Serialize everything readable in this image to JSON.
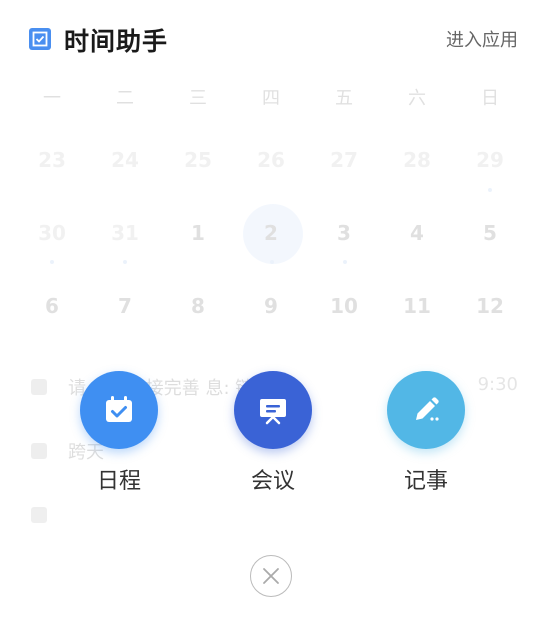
{
  "header": {
    "title": "时间助手",
    "enter_label": "进入应用"
  },
  "calendar": {
    "weekdays": [
      "一",
      "二",
      "三",
      "四",
      "五",
      "六",
      "日"
    ],
    "weeks": [
      [
        "23",
        "24",
        "25",
        "26",
        "27",
        "28",
        "29"
      ],
      [
        "30",
        "31",
        "1",
        "2",
        "3",
        "4",
        "5"
      ],
      [
        "6",
        "7",
        "8",
        "9",
        "10",
        "11",
        "12"
      ]
    ],
    "today": "2"
  },
  "events": [
    {
      "text": "请…    方链接完善    息:    链…",
      "right": "9:30"
    },
    {
      "text": "跨天",
      "right": ""
    },
    {
      "text": "",
      "right": ""
    }
  ],
  "actions": {
    "schedule_label": "日程",
    "meeting_label": "会议",
    "notes_label": "记事"
  },
  "colors": {
    "accent": "#4a8ff0",
    "schedule": "#3f8ff2",
    "meeting": "#3a63d6",
    "notes": "#52b7e6"
  },
  "icons": [
    "app-calendar-check-icon",
    "calendar-check-icon",
    "presentation-board-icon",
    "pencil-icon",
    "close-icon"
  ]
}
